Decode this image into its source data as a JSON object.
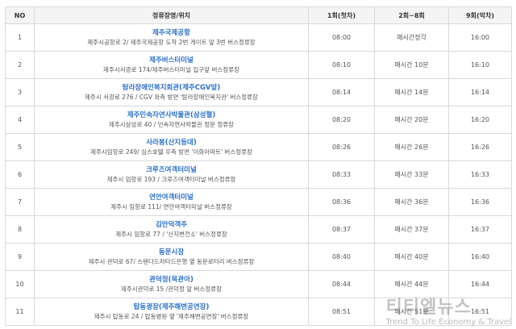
{
  "headers": {
    "no": "NO",
    "name": "정류장명/위치",
    "first": "1회(첫차)",
    "mid": "2회~8회",
    "last": "9회(막차)"
  },
  "rows": [
    {
      "no": "1",
      "name": "제주국제공항",
      "location": "제주시공항로 2/ 제주국제공항 도착 2번 게이트 앞 3번 버스정류장",
      "first": "08:00",
      "interval": "매시간정각",
      "last": "16:00"
    },
    {
      "no": "2",
      "name": "제주버스터미널",
      "location": "제주시서광로 174/제주버스터미널 입구앞 버스정류장",
      "first": "08:10",
      "interval": "매시간 10분",
      "last": "16:10"
    },
    {
      "no": "3",
      "name": "탐라장애인복지회관(제주CGV앞)",
      "location": "제주시 서광로 276 / CGV 좌측 방면 '탐라장애인복지관' 버스정류장",
      "first": "08:14",
      "interval": "매시간 14분",
      "last": "16:14"
    },
    {
      "no": "4",
      "name": "제주민속자연사박물관(삼성혈)",
      "location": "제주시삼성로 40 / 민속자연사박물관 정문 정류장",
      "first": "08:20",
      "interval": "매시간 20분",
      "last": "16:20"
    },
    {
      "no": "5",
      "name": "사라봉(산지등대)",
      "location": "제주시임항로 249/ 심스호텔 우측 방면 '이화아파트' 버스정류장",
      "first": "08:26",
      "interval": "매시간 26분",
      "last": "16:26"
    },
    {
      "no": "6",
      "name": "크루즈여객터미널",
      "location": "제주시 임항로 193 / 크루즈여객터미널 버스정류장",
      "first": "08:33",
      "interval": "매시간 33분",
      "last": "16:33"
    },
    {
      "no": "7",
      "name": "연안여객터미널",
      "location": "제주시 임항로 111/ 연안여객터미널 버스정류장",
      "first": "08:36",
      "interval": "매시간 36분",
      "last": "16:36"
    },
    {
      "no": "8",
      "name": "김만덕객주",
      "location": "제주시 임항로 77 / '산지변전소' 버스정류장",
      "first": "08:37",
      "interval": "매시간 37분",
      "last": "16:37"
    },
    {
      "no": "9",
      "name": "동문시장",
      "location": "제주시 관덕로 67/ 스탠다드차타드은행 옆 동문로터리 버스정류장",
      "first": "08:40",
      "interval": "매시간 40분",
      "last": "16:40"
    },
    {
      "no": "10",
      "name": "관덕정(목관아)",
      "location": "제주시관덕로 15 /관덕정 앞 버스정류장",
      "first": "08:44",
      "interval": "매시간 44분",
      "last": "16:44"
    },
    {
      "no": "11",
      "name": "탑동광장(제주해변공연장)",
      "location": "제주시 탑동로 24 / 탑동병원 옆 '제주해변공연장' 버스정류장",
      "first": "08:51",
      "interval": "매시간 51분",
      "last": "16:51"
    }
  ],
  "watermark": {
    "title": "티티엘뉴스",
    "subtitle": "Trend To Life Economy & Travel"
  }
}
